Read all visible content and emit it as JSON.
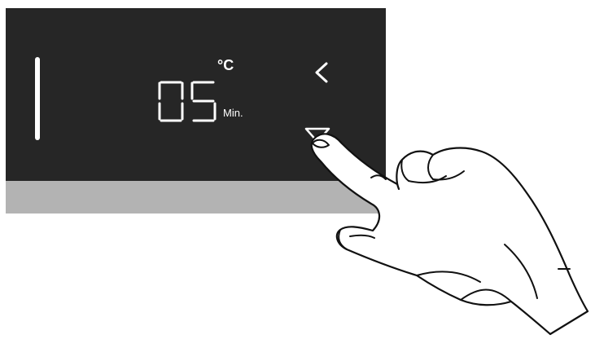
{
  "display": {
    "value": "05",
    "unit_temperature": "°C",
    "unit_time": "Min."
  },
  "icons": {
    "back": "chevron-left-icon",
    "down": "triangle-down-icon",
    "indicator": "vertical-bar-icon"
  },
  "colors": {
    "panel": "#262626",
    "panel_base": "#b3b3b3",
    "display_text": "#ffffff"
  }
}
